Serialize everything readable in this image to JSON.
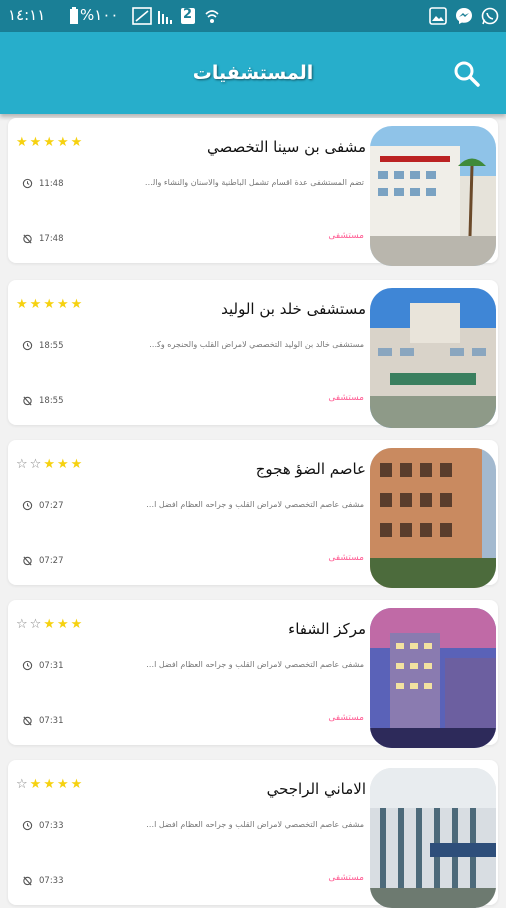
{
  "status_bar": {
    "time": "١٤:١١",
    "battery": "%١٠٠",
    "sim_badge": "2",
    "icons": [
      "whatsapp-icon",
      "messenger-icon",
      "gallery-icon",
      "wifi-icon",
      "signal-icon",
      "battery-icon",
      "screenshot-icon"
    ]
  },
  "app_bar": {
    "title": "المستشفيات",
    "search_icon": "search-icon",
    "color": "#27aecb"
  },
  "hospitals": [
    {
      "name": "مشفى بن سينا التخصصي",
      "rating": 5,
      "description": "تضم المستشفى عدة اقسام تشمل الباطنية والاسنان والنشاء والجراحة والحصول الي...",
      "time_open": "11:48",
      "time_close": "17:48",
      "type": "مستشفى"
    },
    {
      "name": "مستشفى خلد بن الوليد",
      "rating": 5,
      "description": "مستشفى خالد بن الوليد التخصصي لامراض القلب والحنجره وكل ما يخص المواطن السعودي...",
      "time_open": "18:55",
      "time_close": "18:55",
      "type": "مستشفى"
    },
    {
      "name": "عاصم الضؤ هجوج",
      "rating": 3,
      "description": "مشفى عاصم التخصصي لامراض القلب و جراحه العظام افضل انواع العمليات",
      "time_open": "07:27",
      "time_close": "07:27",
      "type": "مستشفى"
    },
    {
      "name": "مركز الشفاء",
      "rating": 3,
      "description": "مشفى عاصم التخصصي لامراض القلب و جراحه العظام افضل انواع العمليات",
      "time_open": "07:31",
      "time_close": "07:31",
      "type": "مستشفى"
    },
    {
      "name": "الاماني الراجحي",
      "rating": 4,
      "description": "مشفى عاصم التخصصي لامراض القلب و جراحه العظام افضل انواع العمليات",
      "time_open": "07:33",
      "time_close": "07:33",
      "type": "مستشفى"
    }
  ]
}
